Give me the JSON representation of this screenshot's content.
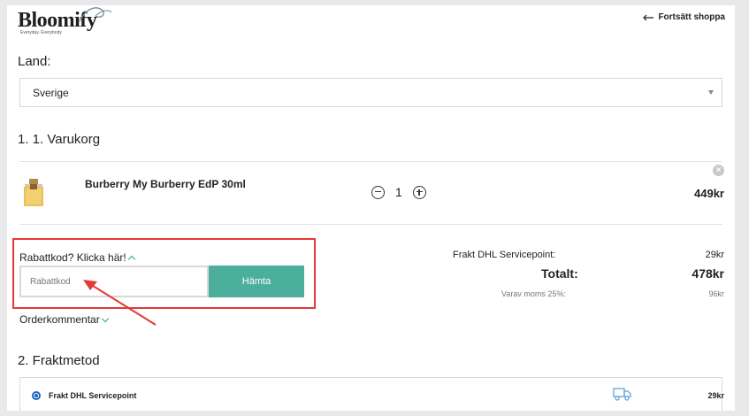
{
  "header": {
    "brand": "Bloomify",
    "tagline": "Everyday. Everybody",
    "continue_label": "Fortsätt shoppa"
  },
  "country": {
    "label": "Land:",
    "selected": "Sverige"
  },
  "cart": {
    "title": "1. 1. Varukorg",
    "items": [
      {
        "name": "Burberry My Burberry EdP 30ml",
        "quantity": "1",
        "price": "449kr",
        "image_icon": "perfume-bottle-icon"
      }
    ]
  },
  "coupon": {
    "toggle_label": "Rabattkod? Klicka här!",
    "placeholder": "Rabattkod",
    "button_label": "Hämta"
  },
  "order_comment": {
    "label": "Orderkommentar"
  },
  "summary": {
    "shipping_label": "Frakt DHL Servicepoint:",
    "shipping_value": "29kr",
    "total_label": "Totalt:",
    "total_value": "478kr",
    "vat_label": "Varav moms 25%:",
    "vat_value": "96kr"
  },
  "shipping_method": {
    "title": "2. Fraktmetod",
    "option_label": "Frakt DHL Servicepoint",
    "option_price": "29kr",
    "option_icon": "truck-icon"
  },
  "colors": {
    "accent": "#4caf9b",
    "highlight": "#e53935",
    "radio": "#1565c0"
  }
}
